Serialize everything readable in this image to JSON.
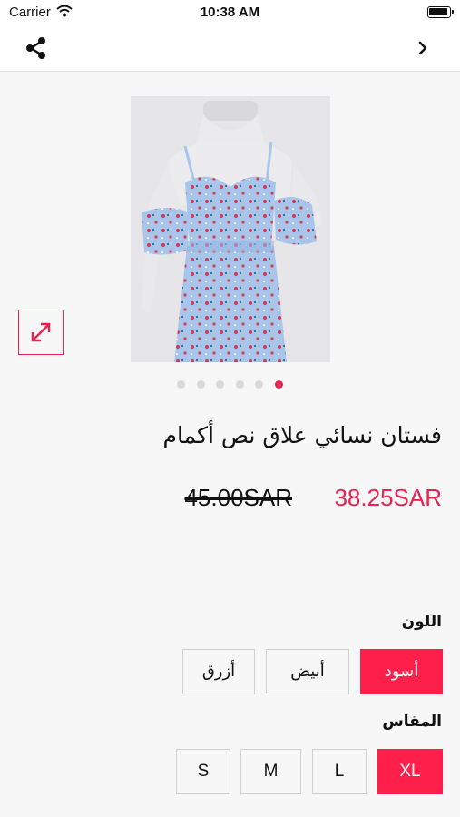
{
  "status_bar": {
    "carrier": "Carrier",
    "time": "10:38 AM"
  },
  "nav": {
    "share_icon": "share-icon",
    "next_icon": "chevron-right-icon"
  },
  "gallery": {
    "image_count": 6,
    "active_index": 5,
    "expand_icon": "expand-arrows-icon"
  },
  "product": {
    "title": "فستان نسائي علاق نص أكمام",
    "price_current": "38.25SAR",
    "price_original": "45.00SAR"
  },
  "options": {
    "color_label": "اللون",
    "colors": [
      "أسود",
      "أبيض",
      "أزرق"
    ],
    "selected_color": "أسود",
    "size_label": "المقاس",
    "sizes": [
      "XL",
      "L",
      "M",
      "S"
    ],
    "selected_size": "XL"
  },
  "theme": {
    "accent": "#ff1f4b",
    "background": "#f7f7f7"
  }
}
